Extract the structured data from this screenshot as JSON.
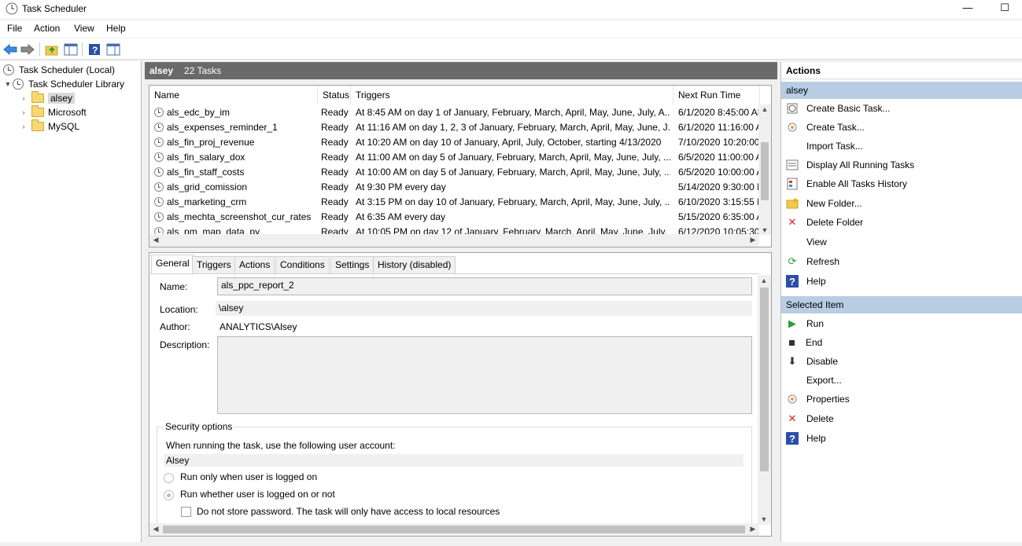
{
  "window": {
    "title": "Task Scheduler",
    "minimize": "—",
    "maximize": "☐"
  },
  "menu": [
    "File",
    "Action",
    "View",
    "Help"
  ],
  "tree": {
    "root": "Task Scheduler (Local)",
    "library": "Task Scheduler Library",
    "folders": [
      "alsey",
      "Microsoft",
      "MySQL"
    ]
  },
  "center": {
    "folder_name": "alsey",
    "task_count": "22 Tasks",
    "columns": [
      "Name",
      "Status",
      "Triggers",
      "Next Run Time"
    ],
    "tasks": [
      {
        "name": "als_edc_by_im",
        "status": "Ready",
        "trigger": "At 8:45 AM  on day 1 of January, February, March, April, May, June, July, A...",
        "next": "6/1/2020 8:45:00 AM"
      },
      {
        "name": "als_expenses_reminder_1",
        "status": "Ready",
        "trigger": "At 11:16 AM  on day 1, 2, 3 of January, February, March, April, May, June, J...",
        "next": "6/1/2020 11:16:00 A"
      },
      {
        "name": "als_fin_proj_revenue",
        "status": "Ready",
        "trigger": "At 10:20 AM  on day 10 of January, April, July, October, starting 4/13/2020",
        "next": "7/10/2020 10:20:00 /"
      },
      {
        "name": "als_fin_salary_dox",
        "status": "Ready",
        "trigger": "At 11:00 AM  on day 5 of January, February, March, April, May, June, July, ...",
        "next": "6/5/2020 11:00:00 A"
      },
      {
        "name": "als_fin_staff_costs",
        "status": "Ready",
        "trigger": "At 10:00 AM  on day 5 of January, February, March, April, May, June, July, ...",
        "next": "6/5/2020 10:00:00 A"
      },
      {
        "name": "als_grid_comission",
        "status": "Ready",
        "trigger": "At 9:30 PM every day",
        "next": "5/14/2020 9:30:00 P"
      },
      {
        "name": "als_marketing_crm",
        "status": "Ready",
        "trigger": "At 3:15 PM  on day 10 of January, February, March, April, May, June, July, ...",
        "next": "6/10/2020 3:15:55 P"
      },
      {
        "name": "als_mechta_screenshot_cur_rates",
        "status": "Ready",
        "trigger": "At 6:35 AM every day",
        "next": "5/15/2020 6:35:00 A"
      },
      {
        "name": "als_pm_map_data_py",
        "status": "Ready",
        "trigger": "At 10:05 PM  on day 12 of January, February, March, April, May, June, July, ...",
        "next": "6/12/2020 10:05:30 I"
      }
    ]
  },
  "detail": {
    "tabs": [
      "General",
      "Triggers",
      "Actions",
      "Conditions",
      "Settings",
      "History (disabled)"
    ],
    "name_label": "Name:",
    "name_value": "als_ppc_report_2",
    "location_label": "Location:",
    "location_value": "\\alsey",
    "author_label": "Author:",
    "author_value": "ANALYTICS\\Alsey",
    "description_label": "Description:",
    "description_value": "",
    "security_title": "Security options",
    "security_prompt": "When running the task, use the following user account:",
    "user_account": "Alsey",
    "radio1": "Run only when user is logged on",
    "radio2": "Run whether user is logged on or not",
    "checkbox1": "Do not store password.  The task will only have access to local resources"
  },
  "actions_pane": {
    "title": "Actions",
    "section1": "alsey",
    "items1": [
      "Create Basic Task...",
      "Create Task...",
      "Import Task...",
      "Display All Running Tasks",
      "Enable All Tasks History",
      "New Folder...",
      "Delete Folder",
      "View",
      "Refresh",
      "Help"
    ],
    "section2": "Selected Item",
    "items2": [
      "Run",
      "End",
      "Disable",
      "Export...",
      "Properties",
      "Delete",
      "Help"
    ]
  }
}
